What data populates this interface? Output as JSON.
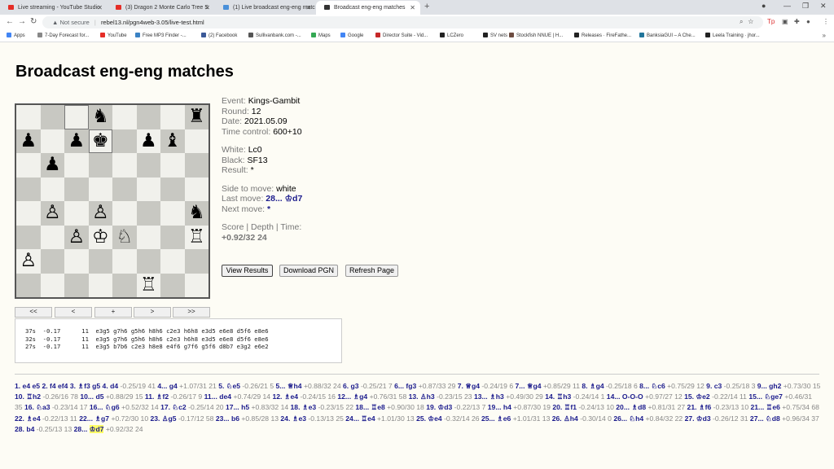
{
  "browser": {
    "tabs": [
      {
        "title": "Live streaming - YouTube Studio",
        "color": "#e52d27",
        "active": false
      },
      {
        "title": "(3) Dragon 2 Monte Carlo Tree S",
        "color": "#e52d27",
        "active": false
      },
      {
        "title": "(1) Live broadcast eng-eng matc",
        "color": "#4a90d9",
        "active": false
      },
      {
        "title": "Broadcast eng-eng matches",
        "color": "#333333",
        "active": true
      }
    ],
    "new_tab": "+",
    "address": {
      "security": "Not secure",
      "url": "rebel13.nl/pgn4web-3.05/live-test.html"
    },
    "bookmarks": [
      {
        "label": "Apps",
        "color": "#4285f4"
      },
      {
        "label": "7-Day Forecast for...",
        "color": "#888888"
      },
      {
        "label": "YouTube",
        "color": "#e52d27"
      },
      {
        "label": "Free MP3 Finder -...",
        "color": "#3b82c4"
      },
      {
        "label": "(2) Facebook",
        "color": "#3b5998"
      },
      {
        "label": "Sullivanbank.com -...",
        "color": "#555555"
      },
      {
        "label": "Maps",
        "color": "#34a853"
      },
      {
        "label": "Google",
        "color": "#4285f4"
      },
      {
        "label": "Director Suite - Vid...",
        "color": "#c62828"
      },
      {
        "label": "LCZero",
        "color": "#222222"
      },
      {
        "label": "SV nets",
        "color": "#222222"
      },
      {
        "label": "Stockfish NNUE | H...",
        "color": "#6d4c41"
      },
      {
        "label": "Releases · FireFathe...",
        "color": "#222222"
      },
      {
        "label": "BanksiaGUI – A Che...",
        "color": "#21759b"
      },
      {
        "label": "Leela Training · jhor...",
        "color": "#222222"
      }
    ],
    "more_bookmarks": "»"
  },
  "page": {
    "title": "Broadcast eng-eng matches",
    "info": {
      "event_label": "Event:",
      "event": "Kings-Gambit",
      "round_label": "Round:",
      "round": "12",
      "date_label": "Date:",
      "date": "2021.05.09",
      "tc_label": "Time control:",
      "tc": "600+10",
      "white_label": "White:",
      "white": "Lc0",
      "black_label": "Black:",
      "black": "SF13",
      "result_label": "Result:",
      "result": "*",
      "side_label": "Side to move:",
      "side": "white",
      "last_label": "Last move:",
      "last": "28... ♔d7",
      "next_label": "Next move:",
      "next": "*",
      "score_label": "Score | Depth | Time:",
      "score": "+0.92/32 24"
    },
    "buttons": {
      "view": "View Results",
      "download": "Download PGN",
      "refresh": "Refresh Page"
    },
    "nav": [
      "<<",
      "<",
      "+",
      ">",
      ">>"
    ],
    "engine_lines": [
      "37s  -0.17      11  e3g5 g7h6 g5h6 h8h6 c2e3 h6h8 e3d5 e6e8 d5f6 e8e6",
      "32s  -0.17      11  e3g5 g7h6 g5h6 h8h6 c2e3 h6h8 e3d5 e6e8 d5f6 e8e6",
      "27s  -0.17      11  e3g5 b7b6 c2e3 h8e8 e4f6 g7f6 g5f6 d8b7 e3g2 e6e2"
    ],
    "board": [
      [
        "",
        "",
        "",
        "♞",
        "",
        "",
        "",
        "♜"
      ],
      [
        "♟",
        "",
        "♟",
        "♚",
        "",
        "♟",
        "♝",
        ""
      ],
      [
        "",
        "♟",
        "",
        "",
        "",
        "",
        "",
        ""
      ],
      [
        "",
        "",
        "",
        "",
        "",
        "",
        "",
        ""
      ],
      [
        "",
        "♙",
        "",
        "♙",
        "",
        "",
        "",
        "♞"
      ],
      [
        "",
        "",
        "♙",
        "♔",
        "♘",
        "",
        "",
        "♖"
      ],
      [
        "♙",
        "",
        "",
        "",
        "",
        "",
        "",
        ""
      ],
      [
        "",
        "",
        "",
        "",
        "",
        "♖",
        "",
        ""
      ]
    ],
    "highlight_squares": [
      "1-3",
      "0-2"
    ],
    "moves": [
      [
        "m",
        "1. e4 e5 2. f4 ef4 3. ♗f3 g5 4. d4"
      ],
      [
        "e",
        " -0.25/19 41 "
      ],
      [
        "m",
        "4... g4"
      ],
      [
        "e",
        " +1.07/31 21 "
      ],
      [
        "m",
        "5. ♘e5"
      ],
      [
        "e",
        " -0.26/21 5 "
      ],
      [
        "m",
        "5... ♕h4"
      ],
      [
        "e",
        " +0.88/32 24 "
      ],
      [
        "m",
        "6. g3"
      ],
      [
        "e",
        " -0.25/21 7 "
      ],
      [
        "m",
        "6... fg3"
      ],
      [
        "e",
        " +0.87/33 29 "
      ],
      [
        "m",
        "7. ♕g4"
      ],
      [
        "e",
        " -0.24/19 6 "
      ],
      [
        "m",
        "7... ♕g4"
      ],
      [
        "e",
        " +0.85/29 11 "
      ],
      [
        "m",
        "8. ♗g4"
      ],
      [
        "e",
        " -0.25/18 6 "
      ],
      [
        "m",
        "8... ♘c6"
      ],
      [
        "e",
        " +0.75/29 12 "
      ],
      [
        "m",
        "9. c3"
      ],
      [
        "e",
        " -0.25/18 3 "
      ],
      [
        "m",
        "9... gh2"
      ],
      [
        "e",
        " +0.73/30 15 "
      ],
      [
        "m",
        "10. ♖h2"
      ],
      [
        "e",
        " -0.26/16 78 "
      ],
      [
        "m",
        "10... d5"
      ],
      [
        "e",
        " +0.88/29 15 "
      ],
      [
        "m",
        "11. ♗f2"
      ],
      [
        "e",
        " -0.26/17 9 "
      ],
      [
        "m",
        "11... de4"
      ],
      [
        "e",
        " +0.74/29 14 "
      ],
      [
        "m",
        "12. ♗e4"
      ],
      [
        "e",
        " -0.24/15 16 "
      ],
      [
        "m",
        "12... ♗g4"
      ],
      [
        "e",
        " +0.76/31 58 "
      ],
      [
        "m",
        "13. ♙h3"
      ],
      [
        "e",
        " -0.23/15 23 "
      ],
      [
        "m",
        "13... ♗h3"
      ],
      [
        "e",
        " +0.49/30 29 "
      ],
      [
        "m",
        "14. ♖h3"
      ],
      [
        "e",
        " -0.24/14 1 "
      ],
      [
        "m",
        "14... O-O-O"
      ],
      [
        "e",
        " +0.97/27 12 "
      ],
      [
        "m",
        "15. ♔e2"
      ],
      [
        "e",
        " -0.22/14 11 "
      ],
      [
        "m",
        "15... ♘ge7"
      ],
      [
        "e",
        " +0.46/31 35 "
      ],
      [
        "m",
        "16. ♘a3"
      ],
      [
        "e",
        " -0.23/14 17 "
      ],
      [
        "m",
        "16... ♘g6"
      ],
      [
        "e",
        " +0.52/32 14 "
      ],
      [
        "m",
        "17. ♘c2"
      ],
      [
        "e",
        " -0.25/14 20 "
      ],
      [
        "m",
        "17... h5"
      ],
      [
        "e",
        " +0.83/32 14 "
      ],
      [
        "m",
        "18. ♗e3"
      ],
      [
        "e",
        " -0.23/15 22 "
      ],
      [
        "m",
        "18... ♖e8"
      ],
      [
        "e",
        " +0.90/30 18 "
      ],
      [
        "m",
        "19. ♔d3"
      ],
      [
        "e",
        " -0.22/13 7 "
      ],
      [
        "m",
        "19... h4"
      ],
      [
        "e",
        " +0.87/30 19 "
      ],
      [
        "m",
        "20. ♖f1"
      ],
      [
        "e",
        " -0.24/13 10 "
      ],
      [
        "m",
        "20... ♗d8"
      ],
      [
        "e",
        " +0.81/31 27 "
      ],
      [
        "m",
        "21. ♗f6"
      ],
      [
        "e",
        " -0.23/13 10 "
      ],
      [
        "m",
        "21... ♖e6"
      ],
      [
        "e",
        " +0.75/34 68 "
      ],
      [
        "m",
        "22. ♗e4"
      ],
      [
        "e",
        " -0.22/13 11 "
      ],
      [
        "m",
        "22... ♗g7"
      ],
      [
        "e",
        " +0.72/30 10 "
      ],
      [
        "m",
        "23. ♙g5"
      ],
      [
        "e",
        " -0.17/12 58 "
      ],
      [
        "m",
        "23... b6"
      ],
      [
        "e",
        " +0.85/28 13 "
      ],
      [
        "m",
        "24. ♗e3"
      ],
      [
        "e",
        " -0.13/13 25 "
      ],
      [
        "m",
        "24... ♖e4"
      ],
      [
        "e",
        " +1.01/30 13 "
      ],
      [
        "m",
        "25. ♔e4"
      ],
      [
        "e",
        " -0.32/14 26 "
      ],
      [
        "m",
        "25... ♗e6"
      ],
      [
        "e",
        " +1.01/31 13 "
      ],
      [
        "m",
        "26. ♙h4"
      ],
      [
        "e",
        " -0.30/14 0 "
      ],
      [
        "m",
        "26... ♘h4"
      ],
      [
        "e",
        " +0.84/32 22 "
      ],
      [
        "m",
        "27. ♔d3"
      ],
      [
        "e",
        " -0.26/12 31 "
      ],
      [
        "m",
        "27... ♘d8"
      ],
      [
        "e",
        " +0.96/34 37 "
      ],
      [
        "m",
        "28. b4"
      ],
      [
        "e",
        " -0.25/13 13 "
      ],
      [
        "m",
        "28... "
      ],
      [
        "c",
        "♔d7"
      ],
      [
        "e",
        " +0.92/32 24"
      ]
    ]
  }
}
